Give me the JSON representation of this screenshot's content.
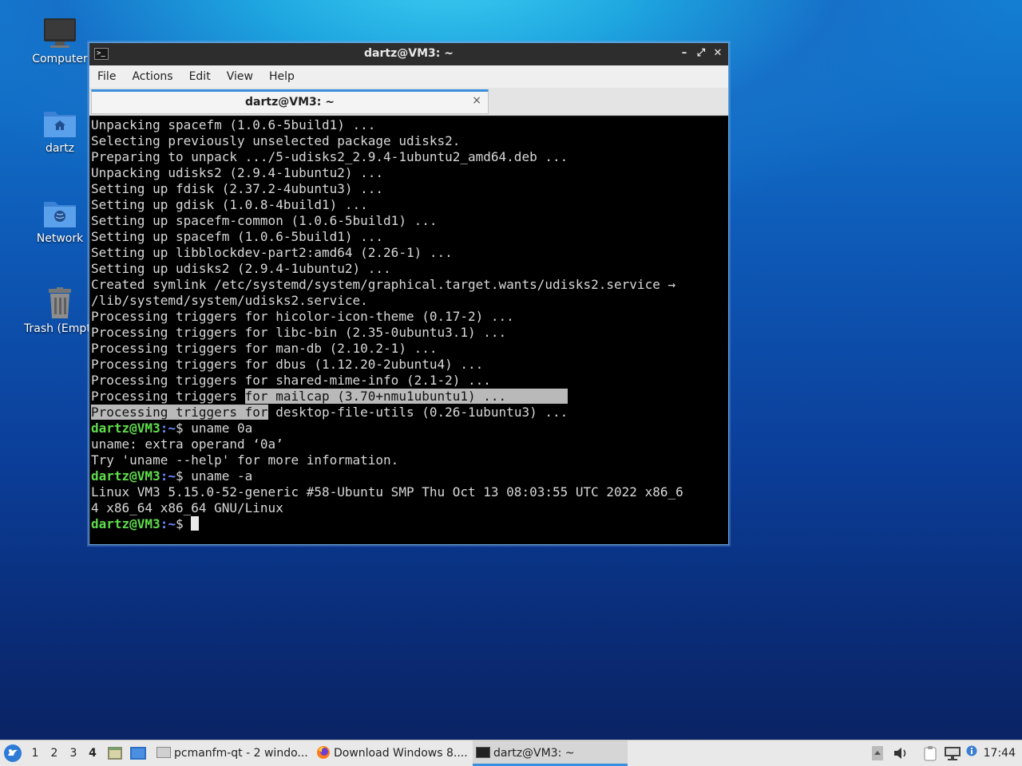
{
  "desktop": {
    "icons": [
      {
        "label": "Computer"
      },
      {
        "label": "dartz"
      },
      {
        "label": "Network"
      },
      {
        "label": "Trash (Empty)"
      }
    ]
  },
  "window": {
    "title": "dartz@VM3: ~",
    "menu": [
      "File",
      "Actions",
      "Edit",
      "View",
      "Help"
    ],
    "tab_label": "dartz@VM3: ~",
    "tab_close": "×",
    "minimize": "–",
    "maximize": "⤢",
    "close": "✕"
  },
  "terminal": {
    "lines": [
      "Unpacking spacefm (1.0.6-5build1) ...",
      "Selecting previously unselected package udisks2.",
      "Preparing to unpack .../5-udisks2_2.9.4-1ubuntu2_amd64.deb ...",
      "Unpacking udisks2 (2.9.4-1ubuntu2) ...",
      "Setting up fdisk (2.37.2-4ubuntu3) ...",
      "Setting up gdisk (1.0.8-4build1) ...",
      "Setting up spacefm-common (1.0.6-5build1) ...",
      "Setting up spacefm (1.0.6-5build1) ...",
      "Setting up libblockdev-part2:amd64 (2.26-1) ...",
      "Setting up udisks2 (2.9.4-1ubuntu2) ...",
      "Created symlink /etc/systemd/system/graphical.target.wants/udisks2.service →",
      "/lib/systemd/system/udisks2.service.",
      "Processing triggers for hicolor-icon-theme (0.17-2) ...",
      "Processing triggers for libc-bin (2.35-0ubuntu3.1) ...",
      "Processing triggers for man-db (2.10.2-1) ...",
      "Processing triggers for dbus (1.12.20-2ubuntu4) ...",
      "Processing triggers for shared-mime-info (2.1-2) ..."
    ],
    "sel1_plain": "Processing triggers ",
    "sel1_selected": "for mailcap (3.70+nmu1ubuntu1) ...        ",
    "sel2_selected": "Processing triggers for",
    "sel2_plain": " desktop-file-utils (0.26-1ubuntu3) ...",
    "prompt_user": "dartz@VM3",
    "prompt_path": ":~",
    "prompt_sign": "$ ",
    "cmd1": "uname 0a",
    "out1a": "uname: extra operand ‘0a’",
    "out1b": "Try 'uname --help' for more information.",
    "cmd2": "uname -a",
    "out2a": "Linux VM3 5.15.0-52-generic #58-Ubuntu SMP Thu Oct 13 08:03:55 UTC 2022 x86_6",
    "out2b": "4 x86_64 x86_64 GNU/Linux"
  },
  "taskbar": {
    "desktops": [
      "1",
      "2",
      "3",
      "4"
    ],
    "active_desktop": "4",
    "tasks": [
      {
        "label": "pcmanfm-qt - 2 windo..."
      },
      {
        "label": "Download Windows 8...."
      },
      {
        "label": "dartz@VM3: ~"
      }
    ],
    "clock": "17:44"
  },
  "colors": {
    "prompt_green": "#5fdd4a",
    "path_blue": "#6a8cff",
    "accent": "#3a8fdc"
  }
}
